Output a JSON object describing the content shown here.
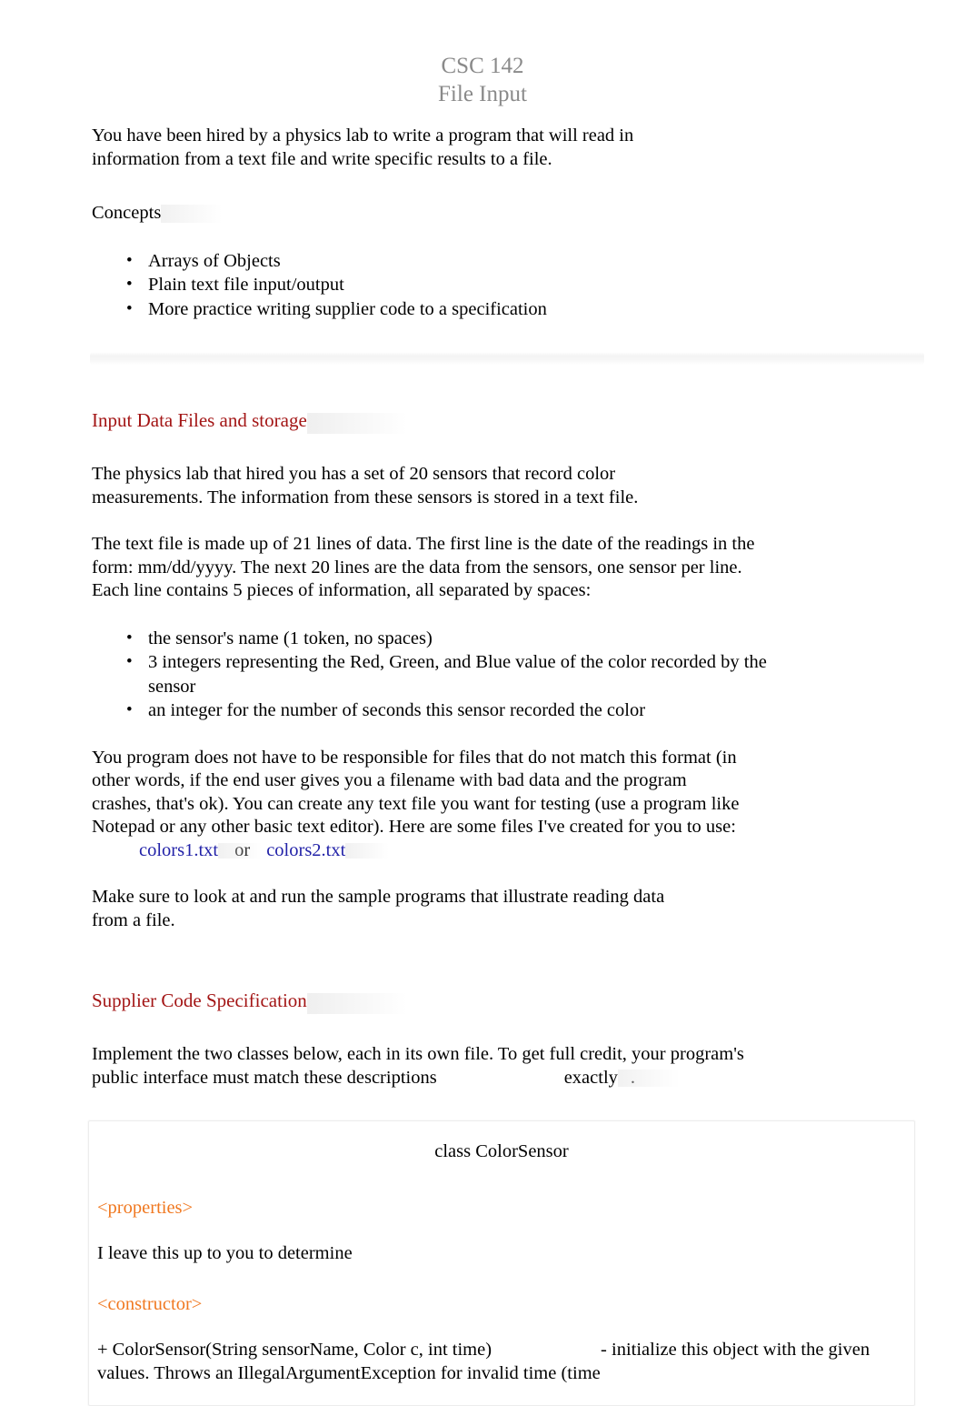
{
  "document": {
    "title": "CSC 142",
    "subtitle": "File Input"
  },
  "intro": {
    "text": "You have been hired by a physics lab to write a program that will read in information from a text file and write specific results to a file."
  },
  "concepts": {
    "heading": "Concepts",
    "items": [
      "Arrays of Objects",
      "Plain text file input/output",
      "More practice writing supplier code to a specification"
    ]
  },
  "input_section": {
    "heading": "Input Data Files and storage",
    "para1": "The physics lab that hired you has a set of 20 sensors that record color measurements. The information from these sensors is stored in a text file.",
    "para2": "The text file is made up of 21 lines of data. The first line is the date of the readings in the form: mm/dd/yyyy. The next 20 lines are the data from the sensors, one sensor per line. Each line contains 5 pieces of information, all separated by spaces:",
    "items": [
      "the sensor's name (1 token, no spaces)",
      "3 integers representing the Red, Green, and Blue value of the color recorded by the sensor",
      "an integer for the number of seconds this sensor recorded the color"
    ],
    "para3_before": "You program does not have to be responsible for files that do not match this format (in other words, if the end user gives you a filename with bad data and the program crashes, that's ok). You can create any text file you want for testing (use a program like Notepad or any other basic text editor). Here are some files I've created for you to use:",
    "link1": "colors1.txt",
    "link_sep": "or",
    "link2": "colors2.txt",
    "para4": "Make sure to look at and run the sample programs that illustrate reading data from a file."
  },
  "supplier_section": {
    "heading": "Supplier Code Specification",
    "para_before": "Implement the two classes below, each in its own file. To get full credit, your program's public interface must match these descriptions",
    "emphasis": "exactly",
    "para_after": "."
  },
  "class_spec": {
    "title": "class ColorSensor",
    "properties_tag": "<properties>",
    "properties_text": "I leave this up to you to determine",
    "constructor_tag": "<constructor>",
    "constructor_signature": "+ ColorSensor(String sensorName, Color c, int time)",
    "constructor_desc": "- initialize this object with the given values. Throws an IllegalArgumentException for invalid time (time"
  },
  "colors": {
    "intro_red": "#7d1518",
    "heading_red": "#a31515",
    "link_blue": "#2222a8",
    "tag_orange": "#f07820",
    "title_gray": "#8a8a8a",
    "body_black": "#000000"
  }
}
